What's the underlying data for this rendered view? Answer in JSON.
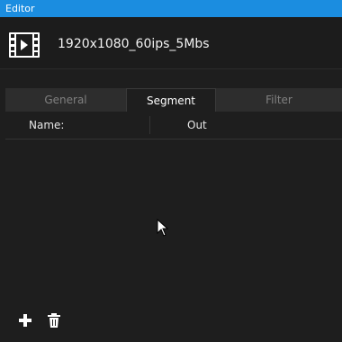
{
  "window": {
    "title": "Editor"
  },
  "header": {
    "file_name": "1920x1080_60ips_5Mbs",
    "icon": "film-icon"
  },
  "tabs": [
    {
      "label": "General",
      "active": false
    },
    {
      "label": "Segment",
      "active": true
    },
    {
      "label": "Filter",
      "active": false
    }
  ],
  "table": {
    "columns": [
      "Name:",
      "Out"
    ],
    "rows": []
  },
  "toolbar": {
    "add_icon": "plus-icon",
    "delete_icon": "trash-icon"
  },
  "colors": {
    "titlebar": "#1b8de0",
    "background": "#1e1e1e",
    "tab_bar": "#2d2d2d"
  }
}
